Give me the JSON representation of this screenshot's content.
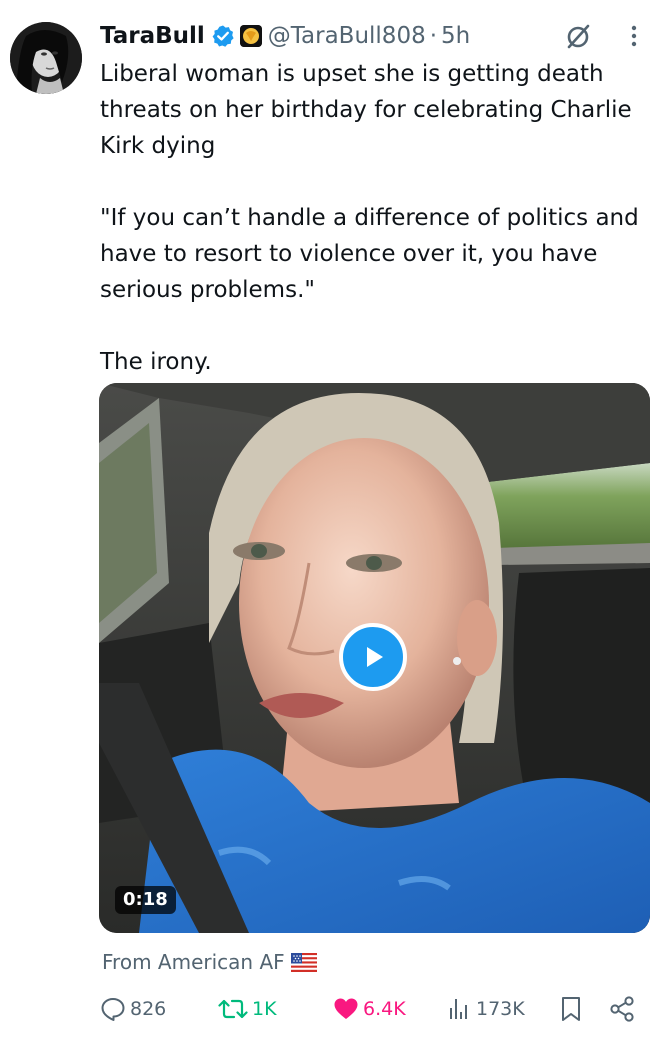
{
  "tweet": {
    "author": {
      "display_name": "TaraBull",
      "handle": "@TaraBull808",
      "time": "5h"
    },
    "separator": "·",
    "text": {
      "line1": "Liberal woman is upset she is getting death threats on her birthday for celebrating Charlie Kirk dying",
      "line2": "\"If you can’t handle a difference of politics and have to resort to violence over it, you have serious problems.\"",
      "line3": "The irony."
    },
    "media": {
      "type": "video",
      "duration": "0:18"
    },
    "source": "From American AF",
    "metrics": {
      "replies": "826",
      "reposts": "1K",
      "likes": "6.4K",
      "views": "173K"
    },
    "state": {
      "liked": true,
      "reposted": true
    }
  },
  "colors": {
    "accent": "#1d9bf0",
    "like": "#f91880",
    "repost": "#00ba7c",
    "muted": "#536471",
    "text": "#0f1419"
  },
  "icons": {
    "verified": "verified-badge-icon",
    "affiliate": "affiliate-badge-icon",
    "grok": "grok-icon",
    "more": "more-options-icon",
    "play": "play-icon",
    "flag": "us-flag-icon",
    "reply": "reply-icon",
    "repost": "repost-icon",
    "like": "heart-icon",
    "views": "views-icon",
    "bookmark": "bookmark-icon",
    "share": "share-icon"
  }
}
